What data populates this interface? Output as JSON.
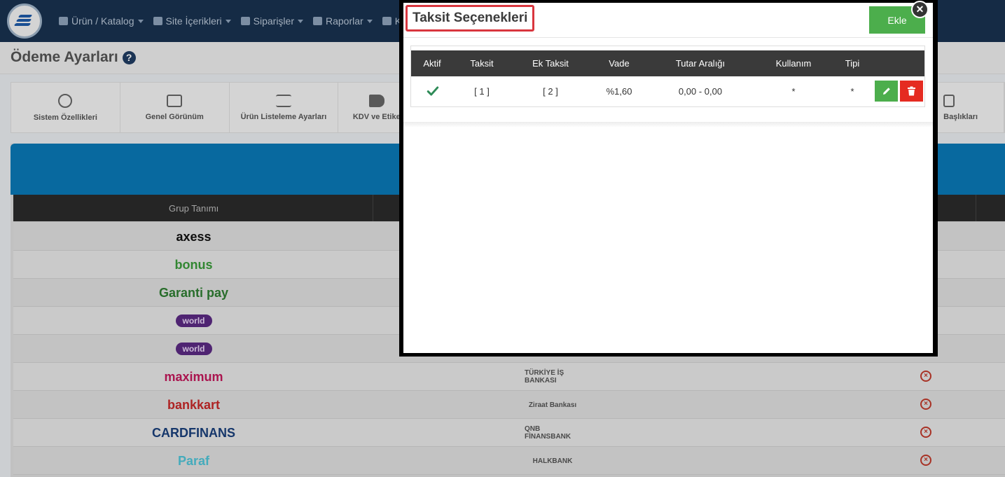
{
  "nav": {
    "items": [
      {
        "label": "Ürün / Katalog"
      },
      {
        "label": "Site İçerikleri"
      },
      {
        "label": "Siparişler"
      },
      {
        "label": "Raporlar"
      },
      {
        "label": "Kull"
      }
    ]
  },
  "page": {
    "title": "Ödeme Ayarları"
  },
  "tabs": [
    {
      "label": "Sistem Özellikleri"
    },
    {
      "label": "Genel Görünüm"
    },
    {
      "label": "Ürün Listeleme Ayarları"
    },
    {
      "label": "KDV ve Etike"
    },
    {
      "label": "Başlıkları"
    }
  ],
  "grid": {
    "header": "Grup Tanımı",
    "rows": [
      {
        "bank": "axess",
        "color": "#111111"
      },
      {
        "bank": "bonus",
        "color": "#3a9a3a"
      },
      {
        "bank": "Garanti pay",
        "color": "#2e7d32"
      },
      {
        "bank": "world",
        "color": "#5b2a82"
      },
      {
        "bank": "world",
        "color": "#5b2a82"
      },
      {
        "bank": "maximum",
        "color": "#c2185b",
        "issuer": "TÜRKİYE İŞ BANKASI"
      },
      {
        "bank": "bankkart",
        "color": "#c62828",
        "issuer": "Ziraat Bankası"
      },
      {
        "bank": "CARDFINANS",
        "color": "#1a3f7a",
        "issuer": "QNB FİNANSBANK"
      },
      {
        "bank": "Paraf",
        "color": "#4fc3d6",
        "issuer": "HALKBANK"
      }
    ]
  },
  "modal": {
    "title": "Taksit Seçenekleri",
    "add_label": "Ekle",
    "close_label": "✕",
    "columns": {
      "active": "Aktif",
      "installment": "Taksit",
      "extra_installment": "Ek Taksit",
      "rate": "Vade",
      "amount_range": "Tutar Aralığı",
      "usage": "Kullanım",
      "type": "Tipi"
    },
    "rows": [
      {
        "installment": "[ 1 ]",
        "extra_installment": "[ 2 ]",
        "rate": "%1,60",
        "amount_range": "0,00 - 0,00",
        "usage": "*",
        "type": "*"
      }
    ]
  },
  "colors": {
    "topbar": "#18324f",
    "panel_accent": "#0a78b5",
    "success": "#4cae4c",
    "danger": "#e52b21",
    "highlight_box": "#d9363e"
  }
}
